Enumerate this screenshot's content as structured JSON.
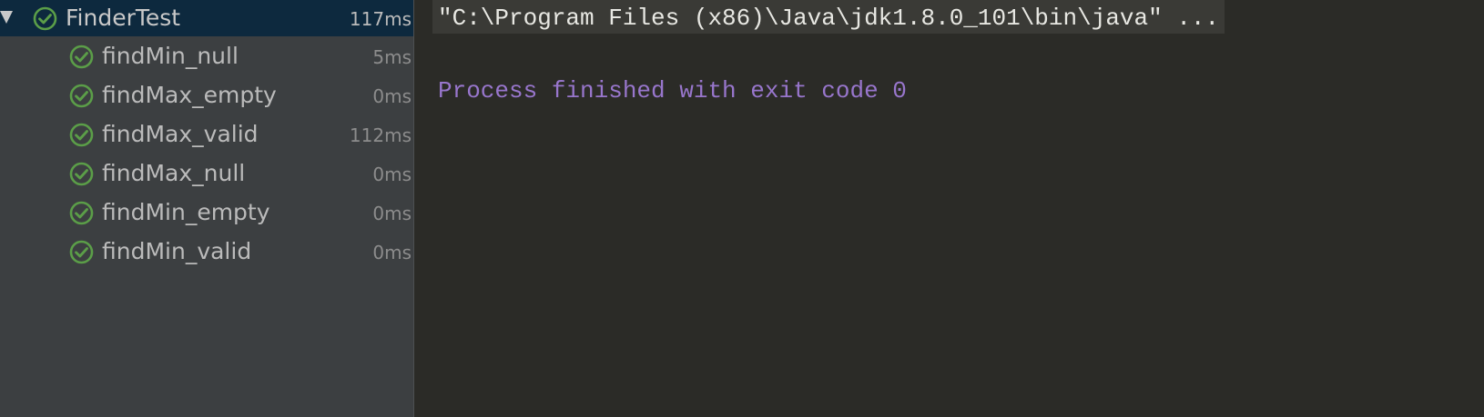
{
  "test_tree": {
    "root": {
      "name": "FinderTest",
      "duration": "117ms",
      "status": "passed",
      "expanded": true,
      "selected": true
    },
    "children": [
      {
        "name": "findMin_null",
        "duration": "5ms",
        "status": "passed"
      },
      {
        "name": "findMax_empty",
        "duration": "0ms",
        "status": "passed"
      },
      {
        "name": "findMax_valid",
        "duration": "112ms",
        "status": "passed"
      },
      {
        "name": "findMax_null",
        "duration": "0ms",
        "status": "passed"
      },
      {
        "name": "findMin_empty",
        "duration": "0ms",
        "status": "passed"
      },
      {
        "name": "findMin_valid",
        "duration": "0ms",
        "status": "passed"
      }
    ]
  },
  "console": {
    "command_line": "\"C:\\Program Files (x86)\\Java\\jdk1.8.0_101\\bin\\java\" ...",
    "exit_message": "Process finished with exit code 0"
  },
  "colors": {
    "tree_background": "#3c3f41",
    "selection_background": "#0d293e",
    "console_background": "#2b2b27",
    "pass_icon": "#5b9e48",
    "exit_message_text": "#9876cc"
  },
  "icons": {
    "expand": "triangle-down",
    "test_status": "check-circle"
  }
}
